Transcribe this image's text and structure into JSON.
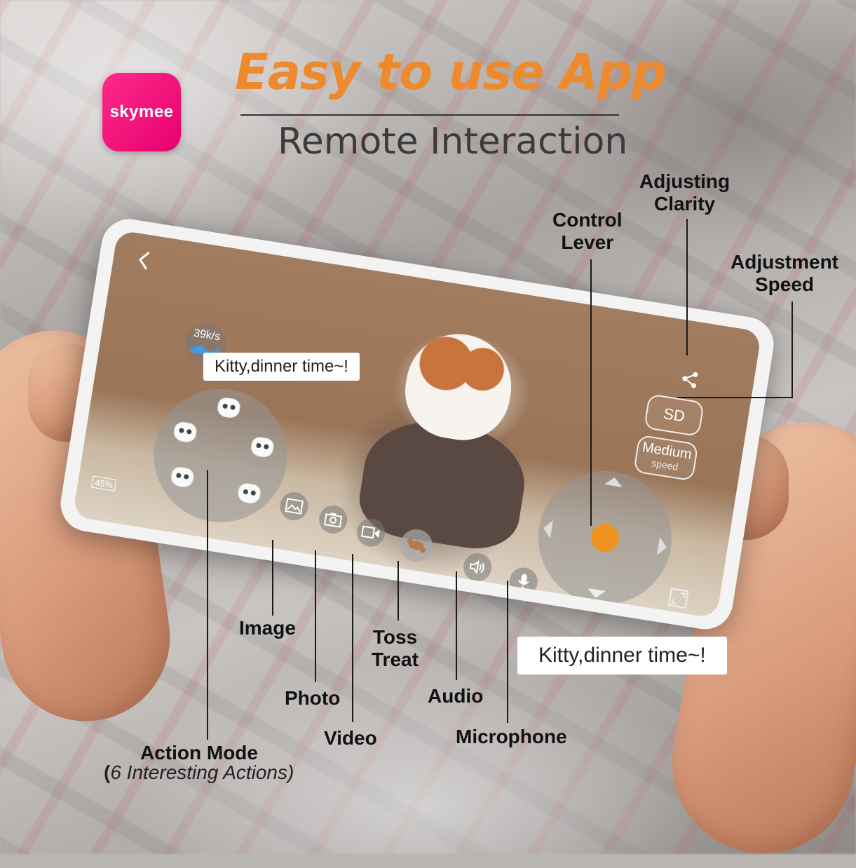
{
  "brand": {
    "app_name": "skymee",
    "color": "#e6006e"
  },
  "header": {
    "title": "Easy to use App",
    "subtitle": "Remote Interaction",
    "title_color": "#ee8a2e"
  },
  "app_screen": {
    "back_icon": "chevron-left-icon",
    "network_speed": "39k/s",
    "battery": "45%",
    "share_icon": "share-icon",
    "clarity_button": "SD",
    "speed_button": "Medium",
    "speed_button_sub": "speed",
    "speech_bubble": "Kitty,dinner time~!",
    "fullscreen_icon": "fullscreen-icon",
    "toolbar": [
      {
        "icon": "image-icon"
      },
      {
        "icon": "camera-icon"
      },
      {
        "icon": "video-camera-icon"
      },
      {
        "icon": "treat-bone-icon"
      },
      {
        "icon": "speaker-icon"
      },
      {
        "icon": "microphone-icon"
      }
    ],
    "joystick_accent": "#ee9320"
  },
  "callouts": {
    "adjusting_clarity": [
      "Adjusting",
      "Clarity"
    ],
    "control_lever": [
      "Control",
      "Lever"
    ],
    "adjustment_speed": [
      "Adjustment",
      "Speed"
    ],
    "image": "Image",
    "photo": "Photo",
    "video": "Video",
    "toss_treat": [
      "Toss",
      "Treat"
    ],
    "audio": "Audio",
    "microphone": "Microphone",
    "action_mode": "Action Mode",
    "action_mode_sub_open": "(",
    "action_mode_sub": "6 Interesting Actions)",
    "speech_bubble": "Kitty,dinner time~!"
  }
}
